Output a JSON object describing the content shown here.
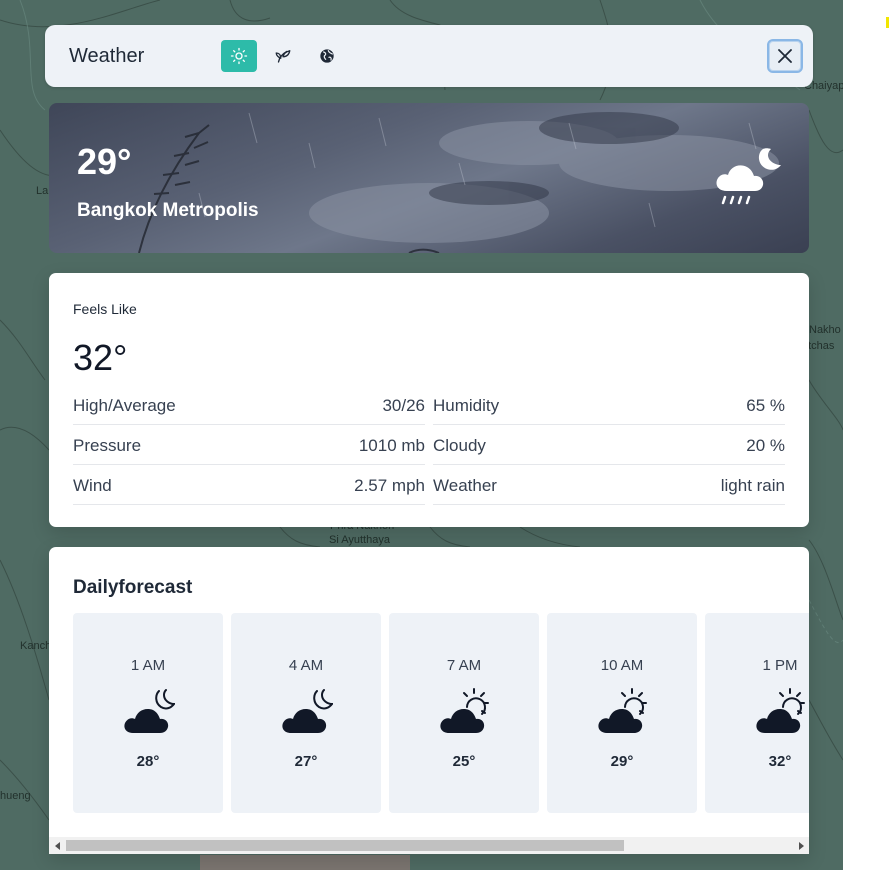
{
  "map": {
    "labels": [
      "Chaiyaphum",
      "La",
      "Nakho",
      "atchas",
      "Phra Nakhon",
      "Si Ayutthaya",
      "Kanch",
      "hueng"
    ]
  },
  "header": {
    "title": "Weather",
    "tabs": [
      {
        "icon": "sun-icon",
        "active": true
      },
      {
        "icon": "leaf-icon",
        "active": false
      },
      {
        "icon": "globe-icon",
        "active": false
      }
    ],
    "close_icon": "close-icon"
  },
  "current": {
    "temp": "29°",
    "city": "Bangkok Metropolis",
    "icon": "cloud-rain-moon-icon"
  },
  "details": {
    "feels_like_label": "Feels Like",
    "feels_like_value": "32°",
    "stats": [
      {
        "label": "High/Average",
        "value": "30/26"
      },
      {
        "label": "Humidity",
        "value": "65 %"
      },
      {
        "label": "Pressure",
        "value": "1010 mb"
      },
      {
        "label": "Cloudy",
        "value": "20 %"
      },
      {
        "label": "Wind",
        "value": "2.57 mph"
      },
      {
        "label": "Weather",
        "value": "light rain"
      }
    ]
  },
  "forecast": {
    "title": "Dailyforecast",
    "items": [
      {
        "time": "1 AM",
        "temp": "28°",
        "icon": "cloud-moon-icon"
      },
      {
        "time": "4 AM",
        "temp": "27°",
        "icon": "cloud-moon-icon"
      },
      {
        "time": "7 AM",
        "temp": "25°",
        "icon": "cloud-sun-icon"
      },
      {
        "time": "10 AM",
        "temp": "29°",
        "icon": "cloud-sun-icon"
      },
      {
        "time": "1 PM",
        "temp": "32°",
        "icon": "cloud-sun-icon"
      }
    ]
  },
  "colors": {
    "accent": "#2dbba9",
    "map": "#4f6b63"
  }
}
